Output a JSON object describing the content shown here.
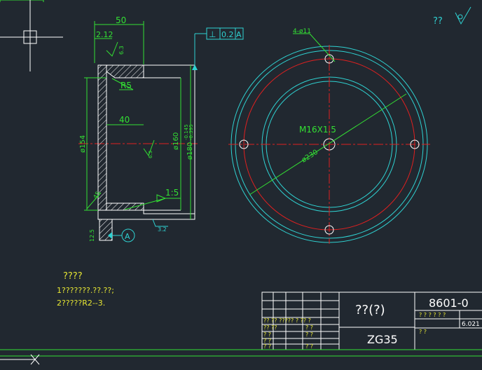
{
  "colors": {
    "background": "#212830",
    "green": "#33e033",
    "cyan": "#2fd2d2",
    "red": "#e02020",
    "white": "#ffffff",
    "yellow": "#e6e633"
  },
  "top_left_label": "? ??? ",
  "roughness_mark": "??",
  "section_view": {
    "dim_top": "50",
    "dim_wall": "2.12",
    "roughness_a": "6.3",
    "radius": "R5",
    "dim_inner": "40",
    "dia_left": "ø154",
    "dia_160": "ø160",
    "dia_180": "ø180",
    "tol_upper": "-0.145",
    "tol_lower": "-0.395",
    "roughness_b": "6.3",
    "angle": "45",
    "taper": "1:5",
    "dim_bottom": "12.5",
    "datum": "A",
    "roughness_c": "3.2"
  },
  "tolerance_frame": {
    "symbol": "⊥",
    "value": "0.2",
    "datum": "A"
  },
  "circular_view": {
    "holes_label": "4-ø11",
    "thread_label": "M16X1.5",
    "pcd_label": "ø230"
  },
  "notes": {
    "title": "????",
    "line1": "1???????.??.??;",
    "line2": "2?????R2--3."
  },
  "title_block": {
    "part_name": "??(?)",
    "material": "ZG35",
    "drawing_no": "8601-0",
    "scale": "6.021",
    "small_header": "?? ??  ????? ?   ?? ?",
    "small_row_a": "? ? ? ? ? ?",
    "row_1": "??  ?? ",
    "row_2": "?  ?",
    "row_3": "?  ?",
    "row_4": "?  ?"
  }
}
